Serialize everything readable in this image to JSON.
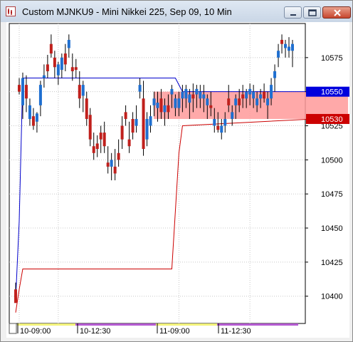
{
  "window": {
    "title": "Custom MJNKU9 - Mini Nikkei 225, Sep 09, 10 Min",
    "icon": "chart-app-icon"
  },
  "controls": {
    "minimize_icon": "minimize-icon",
    "maximize_icon": "maximize-icon",
    "close_icon": "close-icon"
  },
  "colors": {
    "up_candle": "#1f6fd0",
    "down_candle": "#c0201c",
    "upper_line": "#0000cc",
    "lower_line": "#cc0000",
    "zone_fill": "#ff9a9a",
    "ask_tag": "#0000dd",
    "bid_tag": "#cc0000",
    "time_bar_day": "#f2f27a",
    "time_bar_night": "#b35ad0"
  },
  "chart_data": {
    "type": "candlestick",
    "ylim": [
      10380,
      10600
    ],
    "y_ticks": [
      10400,
      10425,
      10450,
      10475,
      10500,
      10525,
      10550,
      10575
    ],
    "time_labels": [
      "10-09:00",
      "10-12:30",
      "11-09:00",
      "11-12:30"
    ],
    "price_tags": {
      "upper": "10550",
      "lower": "10530"
    },
    "zone": [
      10530,
      10550
    ],
    "candles": [
      [
        10405,
        10410,
        10400,
        10395
      ],
      [
        10555,
        10560,
        10548,
        10550
      ],
      [
        10540,
        10564,
        10530,
        10560
      ],
      [
        10555,
        10562,
        10535,
        10545
      ],
      [
        10530,
        10545,
        10525,
        10540
      ],
      [
        10532,
        10538,
        10522,
        10525
      ],
      [
        10528,
        10535,
        10520,
        10534
      ],
      [
        10540,
        10558,
        10532,
        10555
      ],
      [
        10560,
        10570,
        10553,
        10562
      ],
      [
        10570,
        10577,
        10560,
        10565
      ],
      [
        10585,
        10592,
        10575,
        10578
      ],
      [
        10575,
        10580,
        10560,
        10568
      ],
      [
        10562,
        10572,
        10555,
        10570
      ],
      [
        10566,
        10578,
        10560,
        10575
      ],
      [
        10578,
        10585,
        10565,
        10570
      ],
      [
        10582,
        10592,
        10575,
        10588
      ],
      [
        10568,
        10578,
        10558,
        10565
      ],
      [
        10568,
        10574,
        10560,
        10566
      ],
      [
        10555,
        10565,
        10538,
        10545
      ],
      [
        10547,
        10558,
        10535,
        10555
      ],
      [
        10545,
        10550,
        10525,
        10530
      ],
      [
        10533,
        10538,
        10510,
        10515
      ],
      [
        10510,
        10520,
        10500,
        10505
      ],
      [
        10512,
        10518,
        10502,
        10508
      ],
      [
        10520,
        10525,
        10505,
        10515
      ],
      [
        10520,
        10528,
        10505,
        10510
      ],
      [
        10498,
        10510,
        10490,
        10495
      ],
      [
        10495,
        10505,
        10485,
        10500
      ],
      [
        10495,
        10508,
        10485,
        10490
      ],
      [
        10505,
        10515,
        10495,
        10500
      ],
      [
        10525,
        10532,
        10508,
        10515
      ],
      [
        10535,
        10540,
        10525,
        10530
      ],
      [
        10515,
        10528,
        10505,
        10510
      ],
      [
        10530,
        10535,
        10515,
        10520
      ],
      [
        10525,
        10540,
        10520,
        10530
      ],
      [
        10550,
        10560,
        10545,
        10555
      ],
      [
        10545,
        10558,
        10503,
        10508
      ],
      [
        10515,
        10535,
        10510,
        10530
      ],
      [
        10525,
        10540,
        10520,
        10532
      ],
      [
        10540,
        10550,
        10532,
        10545
      ],
      [
        10538,
        10550,
        10528,
        10542
      ],
      [
        10545,
        10552,
        10530,
        10535
      ],
      [
        10535,
        10545,
        10525,
        10540
      ],
      [
        10540,
        10548,
        10530,
        10535
      ],
      [
        10548,
        10555,
        10538,
        10552
      ],
      [
        10538,
        10548,
        10532,
        10545
      ],
      [
        10538,
        10550,
        10532,
        10545
      ],
      [
        10545,
        10555,
        10535,
        10550
      ],
      [
        10545,
        10555,
        10538,
        10552
      ],
      [
        10542,
        10552,
        10530,
        10548
      ],
      [
        10548,
        10556,
        10535,
        10545
      ],
      [
        10548,
        10555,
        10538,
        10552
      ],
      [
        10545,
        10555,
        10538,
        10550
      ],
      [
        10545,
        10555,
        10535,
        10548
      ],
      [
        10540,
        10548,
        10530,
        10545
      ],
      [
        10540,
        10550,
        10532,
        10538
      ],
      [
        10525,
        10538,
        10520,
        10530
      ],
      [
        10525,
        10535,
        10520,
        10522
      ],
      [
        10520,
        10530,
        10515,
        10525
      ],
      [
        10525,
        10535,
        10520,
        10530
      ],
      [
        10545,
        10555,
        10535,
        10540
      ],
      [
        10530,
        10540,
        10525,
        10535
      ],
      [
        10540,
        10548,
        10530,
        10545
      ],
      [
        10545,
        10552,
        10535,
        10540
      ],
      [
        10548,
        10555,
        10538,
        10545
      ],
      [
        10545,
        10552,
        10538,
        10550
      ],
      [
        10548,
        10556,
        10540,
        10552
      ],
      [
        10545,
        10555,
        10538,
        10550
      ],
      [
        10540,
        10550,
        10535,
        10545
      ],
      [
        10545,
        10552,
        10538,
        10548
      ],
      [
        10550,
        10556,
        10542,
        10545
      ],
      [
        10540,
        10550,
        10530,
        10545
      ],
      [
        10545,
        10560,
        10540,
        10555
      ],
      [
        10560,
        10570,
        10550,
        10565
      ],
      [
        10575,
        10585,
        10568,
        10580
      ],
      [
        10588,
        10592,
        10578,
        10585
      ],
      [
        10582,
        10588,
        10575,
        10585
      ],
      [
        10580,
        10590,
        10575,
        10583
      ],
      [
        10580,
        10588,
        10568,
        10585
      ]
    ],
    "upper_line": [
      [
        0,
        10398
      ],
      [
        1,
        10455
      ],
      [
        2,
        10560
      ],
      [
        45,
        10560
      ],
      [
        47,
        10550
      ],
      [
        84,
        10550
      ]
    ],
    "lower_line": [
      [
        0,
        10388
      ],
      [
        1,
        10405
      ],
      [
        2,
        10420
      ],
      [
        44,
        10420
      ],
      [
        46,
        10505
      ],
      [
        47,
        10525
      ],
      [
        84,
        10530
      ]
    ]
  }
}
